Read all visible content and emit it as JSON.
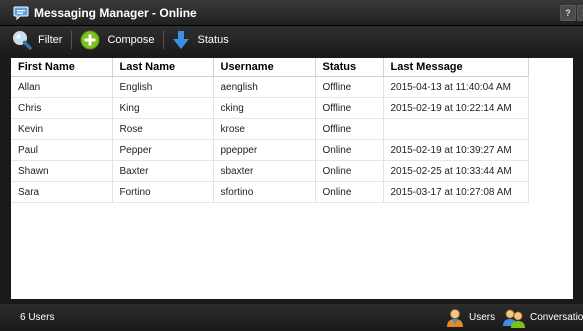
{
  "window": {
    "title": "Messaging Manager - Online",
    "help_label": "?",
    "close_label": "x"
  },
  "toolbar": {
    "filter_label": "Filter",
    "compose_label": "Compose",
    "status_label": "Status"
  },
  "table": {
    "columns": [
      "First Name",
      "Last Name",
      "Username",
      "Status",
      "Last Message"
    ],
    "rows": [
      [
        "Allan",
        "English",
        "aenglish",
        "Offline",
        "2015-04-13 at 11:40:04 AM"
      ],
      [
        "Chris",
        "King",
        "cking",
        "Offline",
        "2015-02-19 at 10:22:14 AM"
      ],
      [
        "Kevin",
        "Rose",
        "krose",
        "Offline",
        ""
      ],
      [
        "Paul",
        "Pepper",
        "ppepper",
        "Online",
        "2015-02-19 at 10:39:27 AM"
      ],
      [
        "Shawn",
        "Baxter",
        "sbaxter",
        "Online",
        "2015-02-25 at 10:33:44 AM"
      ],
      [
        "Sara",
        "Fortino",
        "sfortino",
        "Online",
        "2015-03-17 at 10:27:08 AM"
      ]
    ]
  },
  "statusbar": {
    "count_text": "6 Users",
    "users_label": "Users",
    "conversations_label": "Conversations"
  },
  "icons": {
    "chat": "chat-bubble-icon",
    "filter": "magnifier-icon",
    "compose": "plus-circle-icon",
    "status": "down-arrow-icon",
    "users": "user-icon",
    "conversations": "users-group-icon"
  },
  "colors": {
    "compose_green": "#7cc11e",
    "status_blue": "#3b8fe0",
    "user_orange": "#e08a2a"
  }
}
